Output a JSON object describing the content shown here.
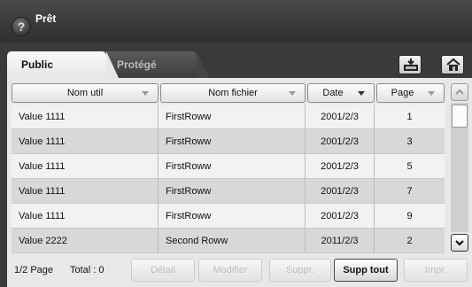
{
  "titlebar": {
    "help_icon": "?",
    "title": "Prêt"
  },
  "tabs": [
    {
      "label": "Public",
      "selected": true
    },
    {
      "label": "Protégé",
      "selected": false
    }
  ],
  "toolbar_icons": [
    "tray-icon",
    "home-icon"
  ],
  "table": {
    "columns": [
      {
        "label": "Nom util"
      },
      {
        "label": "Nom fichier"
      },
      {
        "label": "Date"
      },
      {
        "label": "Page"
      }
    ],
    "rows": [
      [
        "Value 1111",
        "FirstRoww",
        "2001/2/3",
        "1"
      ],
      [
        "Value 1111",
        "FirstRoww",
        "2001/2/3",
        "3"
      ],
      [
        "Value 1111",
        "FirstRoww",
        "2001/2/3",
        "5"
      ],
      [
        "Value 1111",
        "FirstRoww",
        "2001/2/3",
        "7"
      ],
      [
        "Value 1111",
        "FirstRoww",
        "2001/2/3",
        "9"
      ],
      [
        "Value 2222",
        "Second Roww",
        "2011/2/3",
        "2"
      ]
    ]
  },
  "footer": {
    "page": "1/2 Page",
    "total": "Total : 0",
    "buttons": [
      {
        "label": "Détail",
        "enabled": false
      },
      {
        "label": "Modifier",
        "enabled": false
      },
      {
        "label": "Suppr.",
        "enabled": false
      },
      {
        "label": "Supp tout",
        "enabled": true
      },
      {
        "label": "Impr.",
        "enabled": false
      }
    ]
  }
}
